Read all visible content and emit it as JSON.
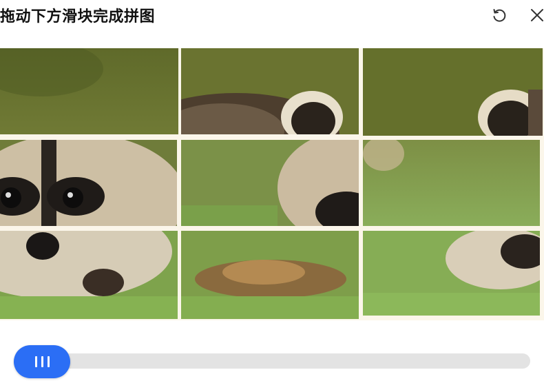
{
  "title": "拖动下方滑块完成拼图",
  "controls": {
    "refresh_icon": "refresh-icon",
    "close_icon": "close-icon"
  },
  "puzzle": {
    "subject": "raccoon-in-grass-photo",
    "rows": 3,
    "cols": 3
  },
  "slider": {
    "handle_icon": "drag-grip-icon",
    "accent": "#2b6ef5",
    "track_color": "#e3e3e3",
    "progress": 0
  }
}
